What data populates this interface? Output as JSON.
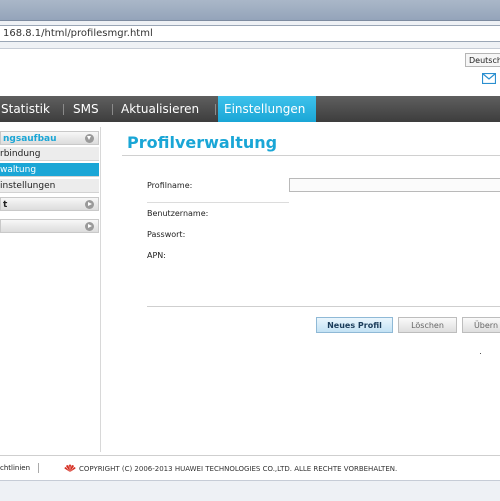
{
  "browser": {
    "url": "168.8.1/html/profilesmgr.html"
  },
  "header": {
    "language": "Deutsch",
    "mail_icon": "mail-icon"
  },
  "nav": {
    "items": [
      {
        "label": "Statistik",
        "active": false
      },
      {
        "label": "SMS",
        "active": false
      },
      {
        "label": "Aktualisieren",
        "active": false
      },
      {
        "label": "Einstellungen",
        "active": true
      }
    ]
  },
  "sidebar": {
    "group_open": "ngsaufbau",
    "sub_items": [
      {
        "label": "rbindung",
        "active": false
      },
      {
        "label": "waltung",
        "active": true
      },
      {
        "label": "instellungen",
        "active": false
      }
    ],
    "group_2": "t",
    "group_3": ""
  },
  "main": {
    "title": "Profilverwaltung",
    "profile_name_label": "Profilname:",
    "profile_name_value": "",
    "username_label": "Benutzername:",
    "password_label": "Passwort:",
    "apn_label": "APN:",
    "buttons": {
      "new": "Neues Profil",
      "delete": "Löschen",
      "apply": "Übern"
    }
  },
  "footer": {
    "link": "chtlinien",
    "copyright": "COPYRIGHT (C) 2006-2013 HUAWEI TECHNOLOGIES CO.,LTD. ALLE RECHTE VORBEHALTEN."
  },
  "colors": {
    "accent": "#1aa6d6",
    "navbar": "#4a4a4a"
  }
}
